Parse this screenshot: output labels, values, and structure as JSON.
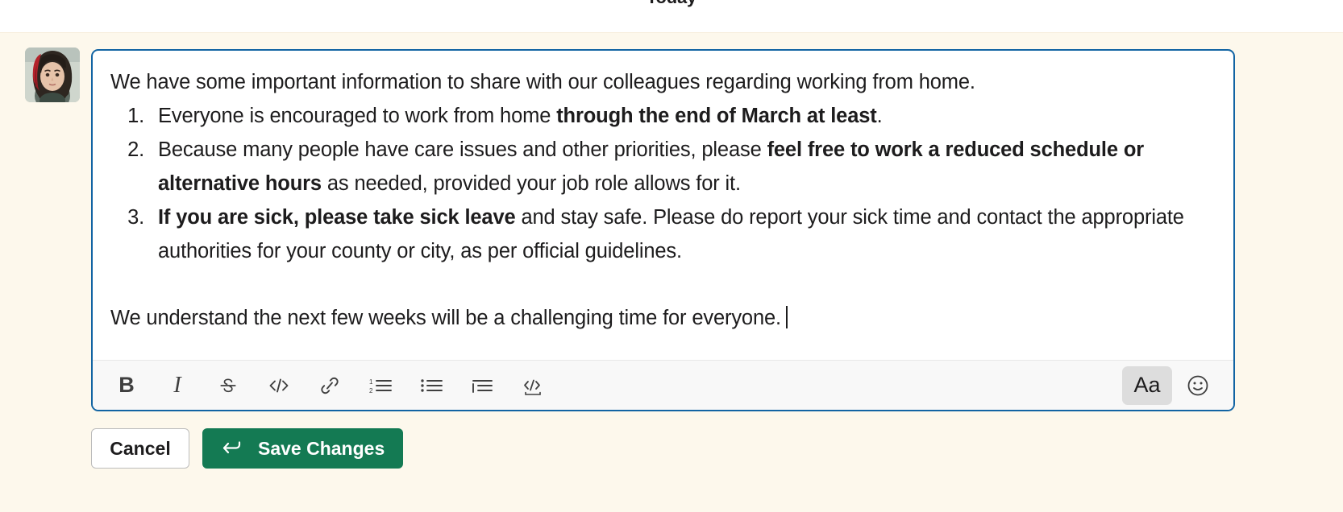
{
  "divider": {
    "label": "Today"
  },
  "message": {
    "avatar_name": "user-avatar",
    "intro": "We have some important information to share with our colleagues regarding working from home.",
    "list": [
      {
        "pre": "Everyone is encouraged to work from home ",
        "bold": "through the end of March at least",
        "post": "."
      },
      {
        "pre": "Because many people have care issues and other priorities, please ",
        "bold": "feel free to work a reduced schedule or alternative hours",
        "post": " as needed, provided your job role allows for it."
      },
      {
        "pre": "",
        "bold": "If you are sick, please take sick leave",
        "post": " and stay safe. Please do report your sick time and contact the appropriate authorities for your county or city, as per official guidelines."
      }
    ],
    "closing": "We understand the next few weeks will be a challenging time for everyone."
  },
  "toolbar": {
    "items": [
      {
        "name": "bold-icon",
        "glyph": "B",
        "label": "Bold"
      },
      {
        "name": "italic-icon",
        "glyph": "I",
        "label": "Italic"
      },
      {
        "name": "strikethrough-icon",
        "glyph": "S",
        "label": "Strikethrough"
      },
      {
        "name": "code-icon",
        "glyph": "</>",
        "label": "Code"
      },
      {
        "name": "link-icon",
        "glyph": "link",
        "label": "Link"
      },
      {
        "name": "ordered-list-icon",
        "glyph": "1.",
        "label": "Ordered list"
      },
      {
        "name": "bulleted-list-icon",
        "glyph": "bullets",
        "label": "Bulleted list"
      },
      {
        "name": "blockquote-icon",
        "glyph": "quote",
        "label": "Blockquote"
      },
      {
        "name": "code-block-icon",
        "glyph": "codeblock",
        "label": "Code block"
      }
    ],
    "format_toggle_label": "Aa",
    "format_toggle_name": "formatting-toggle",
    "emoji_name": "emoji-icon"
  },
  "actions": {
    "cancel_label": "Cancel",
    "save_label": "Save Changes",
    "save_icon_name": "enter-key-icon"
  },
  "colors": {
    "editor_border": "#1264a3",
    "edit_background": "#fdf8ec",
    "save_button": "#147a53",
    "toolbar_background": "#f8f8f8",
    "text": "#1d1c1d"
  }
}
